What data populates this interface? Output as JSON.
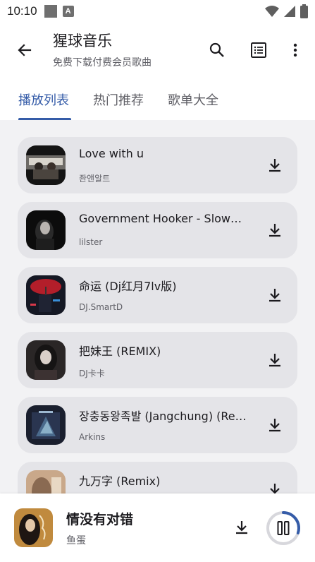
{
  "status_bar": {
    "time": "10:10",
    "badge": "A"
  },
  "app_bar": {
    "title": "猩球音乐",
    "subtitle": "免费下载付费会员歌曲"
  },
  "tabs": [
    {
      "label": "播放列表",
      "active": true
    },
    {
      "label": "热门推荐",
      "active": false
    },
    {
      "label": "歌单大全",
      "active": false
    }
  ],
  "songs": [
    {
      "title": "Love with u",
      "artist": "좐앤알트"
    },
    {
      "title": "Government Hooker - Slowed + Reverb",
      "artist": "lilster"
    },
    {
      "title": "命运 (Dj红月7lv版)",
      "artist": "DJ.SmartD"
    },
    {
      "title": "把妹王 (REMIX)",
      "artist": "DJ卡卡"
    },
    {
      "title": "장충동왕족발 (Jangchung) (Remix)",
      "artist": "Arkins"
    },
    {
      "title": "九万字 (Remix)",
      "artist": ""
    }
  ],
  "now_playing": {
    "title": "情没有对错",
    "artist": "鱼蛋",
    "progress": 0.3
  },
  "colors": {
    "accent": "#355ca8",
    "card": "#e4e4e8",
    "list_bg": "#f2f2f4"
  },
  "icons": {
    "back": "arrow-left-icon",
    "search": "search-icon",
    "list": "list-icon",
    "more": "more-vert-icon",
    "download": "download-icon",
    "pause": "pause-icon"
  }
}
